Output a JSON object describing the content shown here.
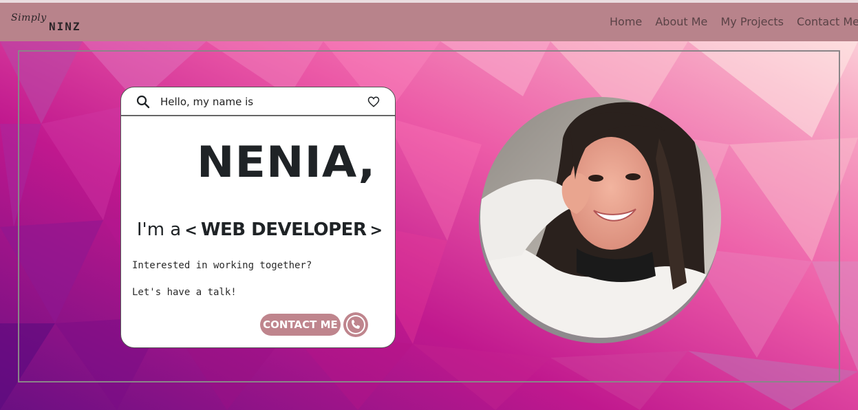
{
  "logo": {
    "script": "Simply",
    "bold": "NINZ"
  },
  "nav": {
    "items": [
      "Home",
      "About Me",
      "My Projects",
      "Contact Me"
    ]
  },
  "card": {
    "greeting": "Hello, my name is",
    "name": "NENIA,",
    "role_prefix": "I'm a",
    "role_open": "<",
    "role": "WEB DEVELOPER",
    "role_close": ">",
    "tagline": "Interested in working together?",
    "tagline2": "Let's have a talk!",
    "contact_label": "CONTACT ME"
  },
  "icons": {
    "search": "search-icon",
    "heart": "heart-icon",
    "phone": "phone-icon"
  },
  "colors": {
    "navbar": "#b8838b",
    "accent": "#bf858d",
    "background_pink": "#e85ca8",
    "background_purple": "#8a1a8c",
    "text_dark": "#1f2326"
  }
}
